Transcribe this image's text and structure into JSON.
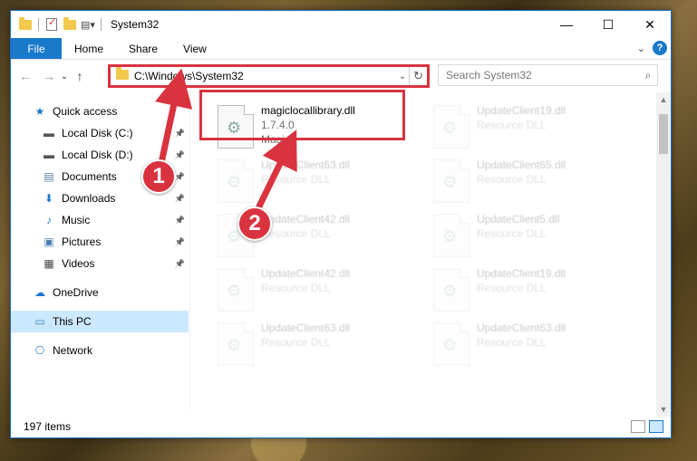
{
  "window": {
    "title": "System32",
    "controls": {
      "minimize": "—",
      "maximize": "☐",
      "close": "✕"
    }
  },
  "ribbon": {
    "tabs": [
      "File",
      "Home",
      "Share",
      "View"
    ],
    "expand_icon": "chevron-down-icon",
    "help_label": "?"
  },
  "nav": {
    "back": "←",
    "forward": "→",
    "recent": "⌄",
    "up": "↑"
  },
  "address": {
    "path": "C:\\Windows\\System32",
    "refresh": "↻",
    "dropdown": "⌄"
  },
  "search": {
    "placeholder": "Search System32",
    "icon": "⌕"
  },
  "sidebar": {
    "items": [
      {
        "label": "Quick access",
        "icon": "star-icon",
        "glyph": "★",
        "color": "#1979ca",
        "pinned": false
      },
      {
        "label": "Local Disk (C:)",
        "icon": "drive-icon",
        "glyph": "▬",
        "color": "#555555",
        "pinned": true
      },
      {
        "label": "Local Disk (D:)",
        "icon": "drive-icon",
        "glyph": "▬",
        "color": "#555555",
        "pinned": true
      },
      {
        "label": "Documents",
        "icon": "documents-icon",
        "glyph": "▤",
        "color": "#5a7fa8",
        "pinned": true
      },
      {
        "label": "Downloads",
        "icon": "downloads-icon",
        "glyph": "⬇",
        "color": "#1979ca",
        "pinned": true
      },
      {
        "label": "Music",
        "icon": "music-icon",
        "glyph": "♪",
        "color": "#1979ca",
        "pinned": true
      },
      {
        "label": "Pictures",
        "icon": "pictures-icon",
        "glyph": "▣",
        "color": "#4a7fb0",
        "pinned": true
      },
      {
        "label": "Videos",
        "icon": "videos-icon",
        "glyph": "▦",
        "color": "#444444",
        "pinned": true
      }
    ],
    "roots": [
      {
        "label": "OneDrive",
        "icon": "onedrive-icon",
        "glyph": "☁",
        "color": "#1979ca"
      },
      {
        "label": "This PC",
        "icon": "computer-icon",
        "glyph": "▭",
        "color": "#3a7ec4",
        "selected": true
      },
      {
        "label": "Network",
        "icon": "network-icon",
        "glyph": "⎔",
        "color": "#3a7ec4"
      }
    ]
  },
  "files": [
    {
      "name": "magiclocallibrary.dll",
      "line2": "1.7.4.0",
      "line3": "Magic",
      "highlighted": true
    },
    {
      "name": "UpdateClient19.dll",
      "line2": "Resource DLL"
    },
    {
      "name": "UpdateClient63.dll",
      "line2": "Resource DLL"
    },
    {
      "name": "UpdateClient65.dll",
      "line2": "Resource DLL"
    },
    {
      "name": "UpdateClient42.dll",
      "line2": "Resource DLL"
    },
    {
      "name": "UpdateClient5.dll",
      "line2": "Resource DLL"
    },
    {
      "name": "UpdateClient42.dll",
      "line2": "Resource DLL"
    },
    {
      "name": "UpdateClient19.dll",
      "line2": "Resource DLL"
    },
    {
      "name": "UpdateClient63.dll",
      "line2": "Resource DLL"
    },
    {
      "name": "UpdateClient63.dll",
      "line2": "Resource DLL"
    }
  ],
  "status": {
    "count": "197 items"
  },
  "annotations": [
    {
      "label": "1"
    },
    {
      "label": "2"
    }
  ],
  "colors": {
    "accent": "#1979ca",
    "highlight": "#d9333f",
    "selected_bg": "#cce8ff"
  }
}
